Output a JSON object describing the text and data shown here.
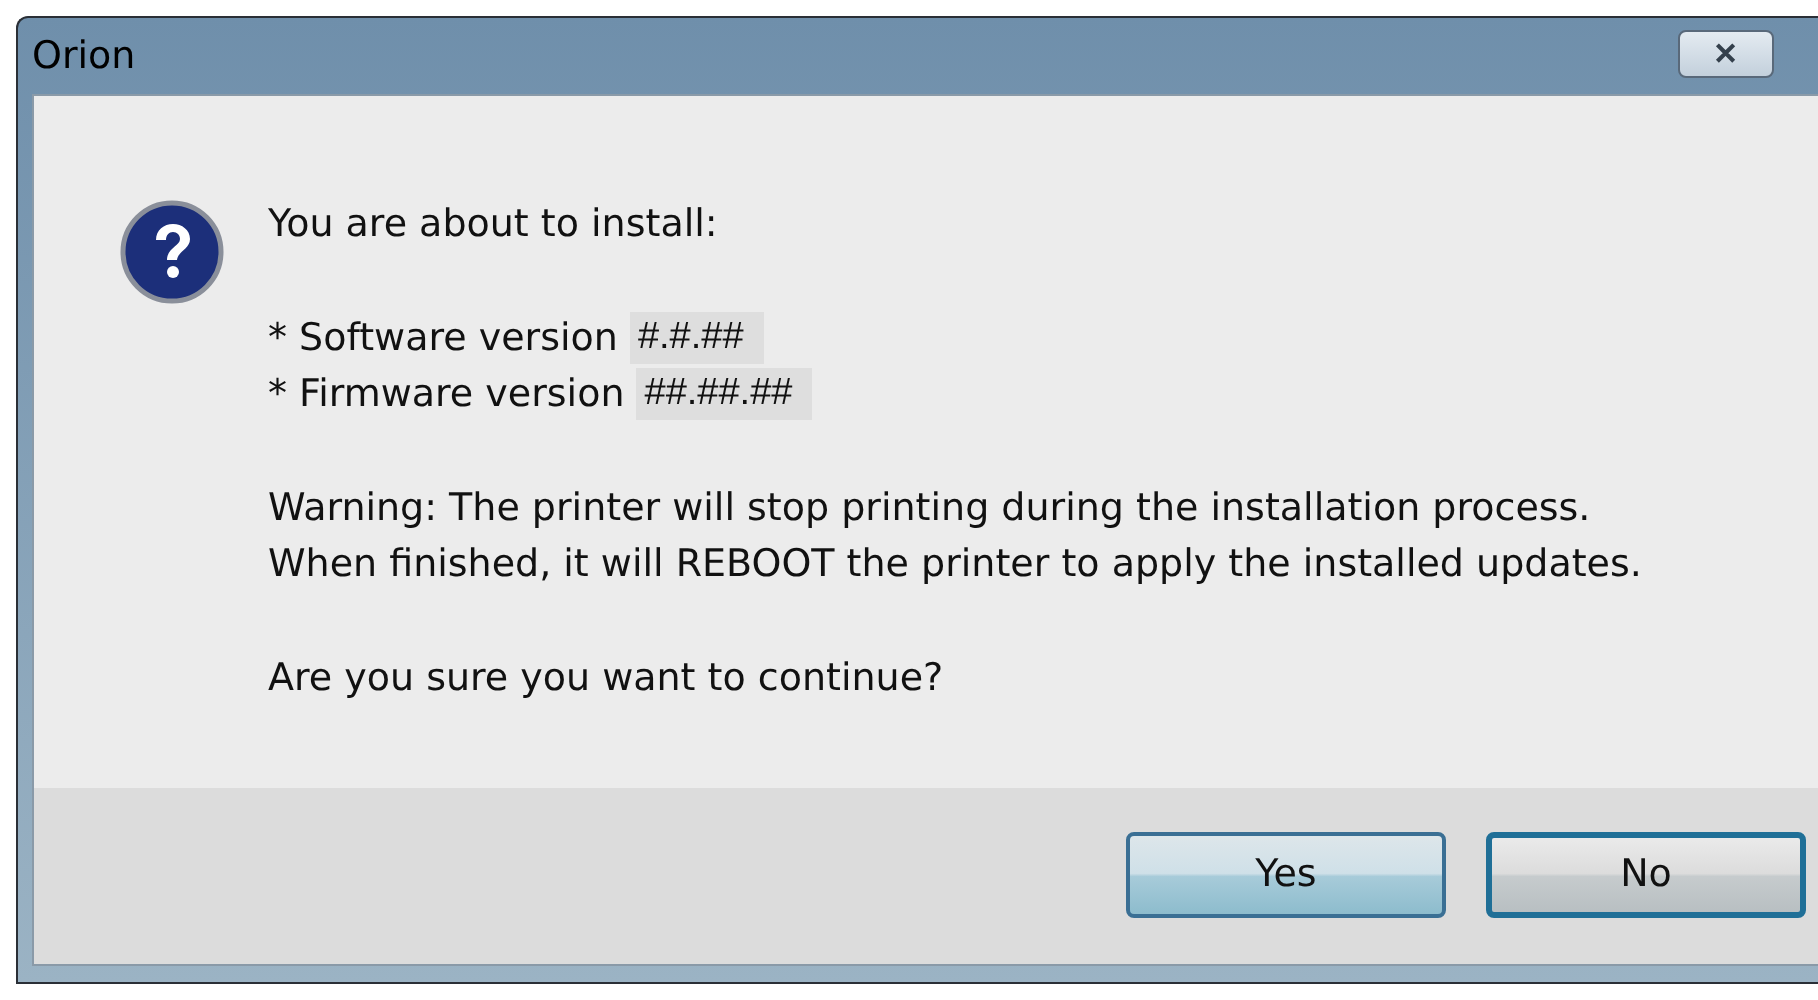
{
  "window": {
    "title": "Orion",
    "close_glyph": "✕"
  },
  "message": {
    "heading": "You are about to install:",
    "versions": [
      {
        "label": "* Software version",
        "value": "#.#.##"
      },
      {
        "label": "* Firmware version",
        "value": "##.##.##"
      }
    ],
    "warning": [
      "Warning: The printer will stop printing during the installation process.",
      "When finished, it will REBOOT the printer to apply the installed updates."
    ],
    "question": "Are you sure you want to continue?"
  },
  "buttons": [
    {
      "label": "Yes",
      "default": false
    },
    {
      "label": "No",
      "default": true
    }
  ]
}
